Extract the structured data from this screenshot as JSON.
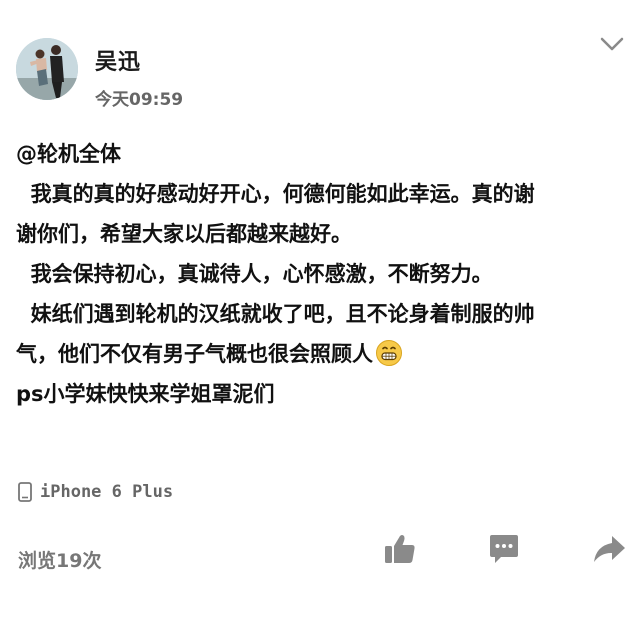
{
  "author": {
    "name": "吴迅",
    "time": "今天09:59"
  },
  "post": {
    "lines": [
      "@轮机全体",
      "  我真的真的好感动好开心，何德何能如此幸运。真的谢",
      "谢你们，希望大家以后都越来越好。",
      "  我会保持初心，真诚待人，心怀感激，不断努力。",
      "  妹纸们遇到轮机的汉纸就收了吧，且不论身着制服的帅",
      "气，他们不仅有男子气概也很会照顾人",
      "ps小学妹快快来学姐罩泥们"
    ]
  },
  "device": {
    "label": "iPhone 6 Plus"
  },
  "stats": {
    "views": "浏览19次"
  },
  "icons": {
    "menu": "chevron-down-icon",
    "device": "phone-icon",
    "like": "thumbs-up-icon",
    "comment": "comment-icon",
    "share": "share-icon",
    "emoji": "grin-emoji-icon"
  },
  "colors": {
    "icon_gray": "#8a8a8a",
    "muted_text": "#666666"
  }
}
